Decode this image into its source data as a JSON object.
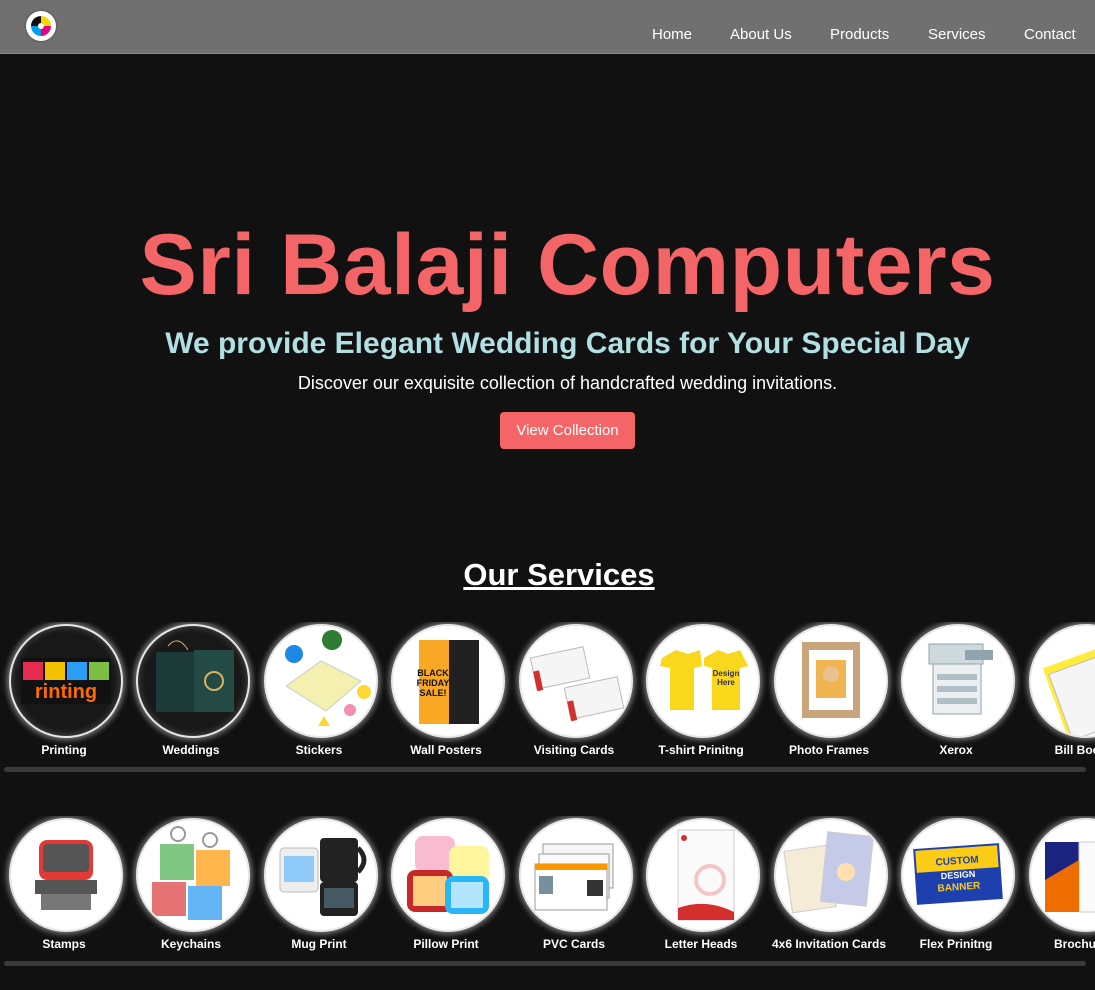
{
  "nav": {
    "logo_icon": "cmyk-logo-icon",
    "links": [
      "Home",
      "About Us",
      "Products",
      "Services",
      "Contact"
    ]
  },
  "hero": {
    "title": "Sri Balaji Computers",
    "subtitle": "We provide Elegant Wedding Cards for Your Special Day",
    "description": "Discover our exquisite collection of handcrafted wedding invitations.",
    "button_label": "View Collection"
  },
  "services": {
    "title": "Our Services",
    "row1": [
      {
        "label": "Printing",
        "icon": "printing-icon"
      },
      {
        "label": "Weddings",
        "icon": "wedding-card-icon"
      },
      {
        "label": "Stickers",
        "icon": "stickers-icon"
      },
      {
        "label": "Wall Posters",
        "icon": "poster-icon"
      },
      {
        "label": "Visiting Cards",
        "icon": "visiting-cards-icon"
      },
      {
        "label": "T-shirt Prinitng",
        "icon": "tshirt-icon"
      },
      {
        "label": "Photo Frames",
        "icon": "photo-frame-icon"
      },
      {
        "label": "Xerox",
        "icon": "photocopier-icon"
      },
      {
        "label": "Bill Books",
        "icon": "bill-book-icon"
      }
    ],
    "row2": [
      {
        "label": "Stamps",
        "icon": "stamp-icon"
      },
      {
        "label": "Keychains",
        "icon": "keychain-icon"
      },
      {
        "label": "Mug Print",
        "icon": "mug-icon"
      },
      {
        "label": "Pillow Print",
        "icon": "pillow-icon"
      },
      {
        "label": "PVC Cards",
        "icon": "id-card-icon"
      },
      {
        "label": "Letter Heads",
        "icon": "letterhead-icon"
      },
      {
        "label": "4x6 Invitation Cards",
        "icon": "invitation-card-icon"
      },
      {
        "label": "Flex Prinitng",
        "icon": "flex-banner-icon"
      },
      {
        "label": "Brochures",
        "icon": "brochure-icon"
      }
    ]
  },
  "colors": {
    "accent": "#f46567",
    "subtitle": "#b1dfe2",
    "nav_bg": "#717071",
    "page_bg": "#121112"
  }
}
